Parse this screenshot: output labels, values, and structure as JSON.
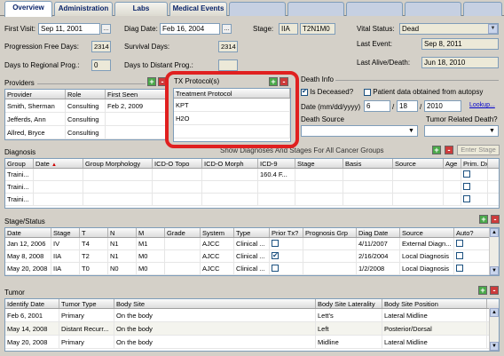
{
  "tabs": [
    "Overview",
    "Administration",
    "Labs",
    "Medical Events",
    "",
    ""
  ],
  "header": {
    "first_visit_label": "First Visit:",
    "first_visit": "Sep 11, 2001",
    "diag_date_label": "Diag Date:",
    "diag_date": "Feb 16, 2004",
    "stage_label": "Stage:",
    "stage": "IIA",
    "tnm": "T2N1M0",
    "vital_status_label": "Vital Status:",
    "vital_status": "Dead",
    "pfd_label": "Progression Free Days:",
    "pfd": "2314",
    "survival_label": "Survival Days:",
    "survival": "2314",
    "last_event_label": "Last Event:",
    "last_event": "Sep 8, 2011",
    "regional_label": "Days to Regional Prog.:",
    "regional": "0",
    "distant_label": "Days to Distant Prog.:",
    "distant": "",
    "last_alive_label": "Last Alive/Death:",
    "last_alive": "Jun 18, 2010"
  },
  "providers": {
    "title": "Providers",
    "columns": [
      "Provider",
      "Role",
      "First Seen"
    ],
    "rows": [
      [
        "Smith, Sherman",
        "Consulting",
        "Feb 2, 2009"
      ],
      [
        "Jefferds, Ann",
        "Consulting",
        ""
      ],
      [
        "Allred, Bryce",
        "Consulting",
        ""
      ]
    ]
  },
  "tx": {
    "title": "TX Protocol(s)",
    "column": "Treatment Protocol",
    "rows": [
      "KPT",
      "H2O",
      ""
    ]
  },
  "death": {
    "title": "Death Info",
    "is_deceased": "Is Deceased?",
    "autopsy": "Patient data obtained from autopsy",
    "date_label": "Date (mm/dd/yyyy)",
    "mm": "6",
    "dd": "18",
    "yyyy": "2010",
    "lookup": "Lookup...",
    "source_label": "Death Source",
    "tumor_related": "Tumor Related Death?"
  },
  "diagnosis": {
    "title": "Diagnosis",
    "show_all": "Show Diagnoses And Stages For All Cancer Groups",
    "enter_stage": "Enter Stage",
    "columns": [
      "Group",
      "Date",
      "Group Morphology",
      "ICD-O Topo",
      "ICD-O Morph",
      "ICD-9",
      "Stage",
      "Basis",
      "Source",
      "Age",
      "Prim. Dx"
    ],
    "rows": [
      [
        "Traini...",
        "",
        "",
        "",
        "",
        "160.4 F...",
        "",
        "",
        "",
        ""
      ],
      [
        "Traini...",
        "",
        "",
        "",
        "",
        "",
        "",
        "",
        "",
        ""
      ],
      [
        "Traini...",
        "",
        "",
        "",
        "",
        "",
        "",
        "",
        "",
        ""
      ]
    ]
  },
  "stage": {
    "title": "Stage/Status",
    "columns": [
      "Date",
      "Stage",
      "T",
      "N",
      "M",
      "Grade",
      "System",
      "Type",
      "Prior Tx?",
      "Prognosis Grp",
      "Diag Date",
      "Source",
      "Auto?"
    ],
    "rows": [
      [
        "Jan 12, 2006",
        "IV",
        "T4",
        "N1",
        "M1",
        "",
        "AJCC",
        "Clinical ...",
        "",
        "",
        "4/11/2007",
        "External Diagn...",
        ""
      ],
      [
        "May 8, 2008",
        "IIA",
        "T2",
        "N1",
        "M0",
        "",
        "AJCC",
        "Clinical ...",
        "",
        "",
        "2/16/2004",
        "Local Diagnosis",
        ""
      ],
      [
        "May 20, 2008",
        "IIA",
        "T0",
        "N0",
        "M0",
        "",
        "AJCC",
        "Clinical ...",
        "",
        "",
        "1/2/2008",
        "Local Diagnosis",
        ""
      ]
    ]
  },
  "tumor": {
    "title": "Tumor",
    "columns": [
      "Identify Date",
      "Tumor Type",
      "Body Site",
      "Body Site Laterality",
      "Body Site Position"
    ],
    "rows": [
      [
        "Feb 6, 2001",
        "Primary",
        "On the body",
        "Lett's",
        "Lateral Midline"
      ],
      [
        "May 14, 2008",
        "Distant Recurr...",
        "On the body",
        "Left",
        "Posterior/Dorsal"
      ],
      [
        "May 20, 2008",
        "Primary",
        "On the body",
        "Midline",
        "Lateral Midline"
      ]
    ]
  }
}
